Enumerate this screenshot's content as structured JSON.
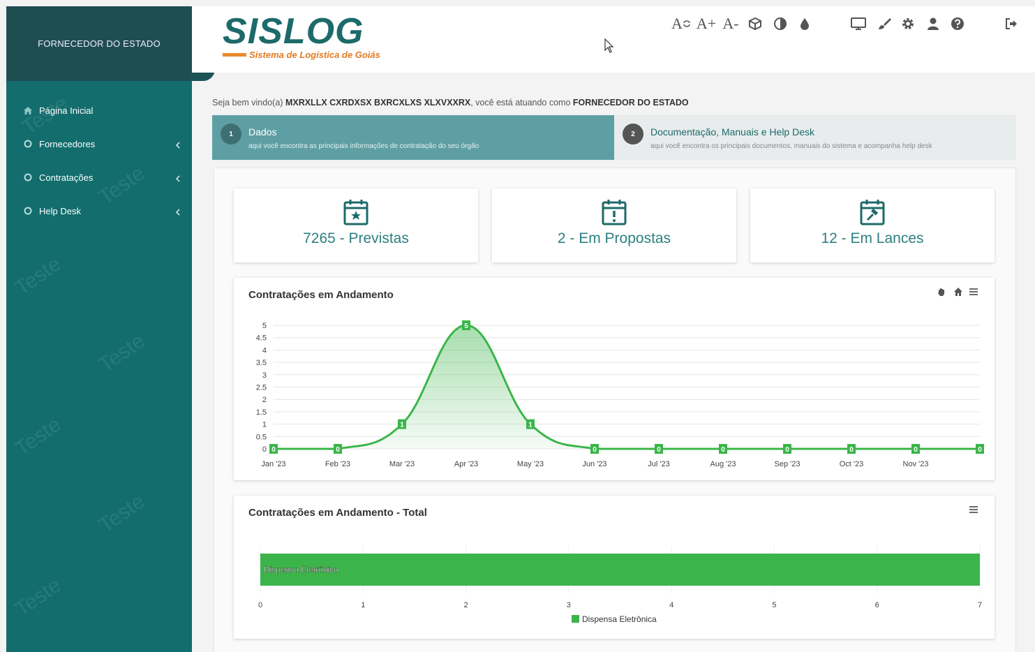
{
  "sidebar": {
    "role": "FORNECEDOR DO ESTADO",
    "items": [
      {
        "label": "Página Inicial",
        "icon": "home-icon",
        "chevron": false
      },
      {
        "label": "Fornecedores",
        "icon": "circle-icon",
        "chevron": true
      },
      {
        "label": "Contratações",
        "icon": "circle-icon",
        "chevron": true
      },
      {
        "label": "Help Desk",
        "icon": "circle-icon",
        "chevron": true
      }
    ],
    "watermark": "Teste"
  },
  "header": {
    "logo_text": "SISLOG",
    "logo_subtitle": "Sistema de Logística de Goiás",
    "tools": {
      "font_reset": "A",
      "font_increase": "A+",
      "font_decrease": "A-"
    }
  },
  "welcome": {
    "prefix": "Seja bem vindo(a)",
    "user": "MXRXLLX CXRDXSX BXRCXLXS XLXVXXRX",
    "middle": ", você está atuando como",
    "role": "FORNECEDOR DO ESTADO"
  },
  "steps": [
    {
      "num": "1",
      "title": "Dados",
      "desc": "aqui você encontra as principais informações de contratação do seu órgão"
    },
    {
      "num": "2",
      "title": "Documentação, Manuais e Help Desk",
      "desc": "aqui você encontra os principais documentos, manuais do sistema e acompanha help desk"
    }
  ],
  "cards": [
    {
      "label": "7265 - Previstas",
      "icon": "calendar-star-icon"
    },
    {
      "label": "2 - Em Propostas",
      "icon": "calendar-alert-icon"
    },
    {
      "label": "12 - Em Lances",
      "icon": "calendar-gavel-icon"
    }
  ],
  "colors": {
    "sidebar": "#136d6d",
    "sidebar_header": "#1f4e51",
    "accent": "#2d7f80",
    "series_green": "#3bb54a",
    "logo_orange": "#e07a24"
  },
  "chart_data": [
    {
      "type": "area",
      "title": "Contratações em Andamento",
      "categories": [
        "Jan '23",
        "Feb '23",
        "Mar '23",
        "Apr '23",
        "May '23",
        "Jun '23",
        "Jul '23",
        "Aug '23",
        "Sep '23",
        "Oct '23",
        "Nov '23",
        ""
      ],
      "values": [
        0,
        0,
        1,
        5,
        1,
        0,
        0,
        0,
        0,
        0,
        0,
        0
      ],
      "yticks": [
        "0",
        "0.5",
        "1",
        "1.5",
        "2",
        "2.5",
        "3",
        "3.5",
        "4",
        "4.5",
        "5"
      ],
      "ylim": [
        0,
        5
      ],
      "grid": true,
      "toolbar_icons": [
        "pan-hand-icon",
        "home-icon",
        "menu-icon"
      ]
    },
    {
      "type": "bar",
      "orientation": "horizontal",
      "title": "Contratações em Andamento - Total",
      "categories": [
        "Dispensa Eletrônica"
      ],
      "values": [
        7
      ],
      "xticks": [
        "0",
        "1",
        "2",
        "3",
        "4",
        "5",
        "6",
        "7"
      ],
      "xlim": [
        0,
        7
      ],
      "legend": "Dispensa Eletrônica",
      "legend_position": "bottom-center",
      "toolbar_icons": [
        "menu-icon"
      ]
    }
  ]
}
